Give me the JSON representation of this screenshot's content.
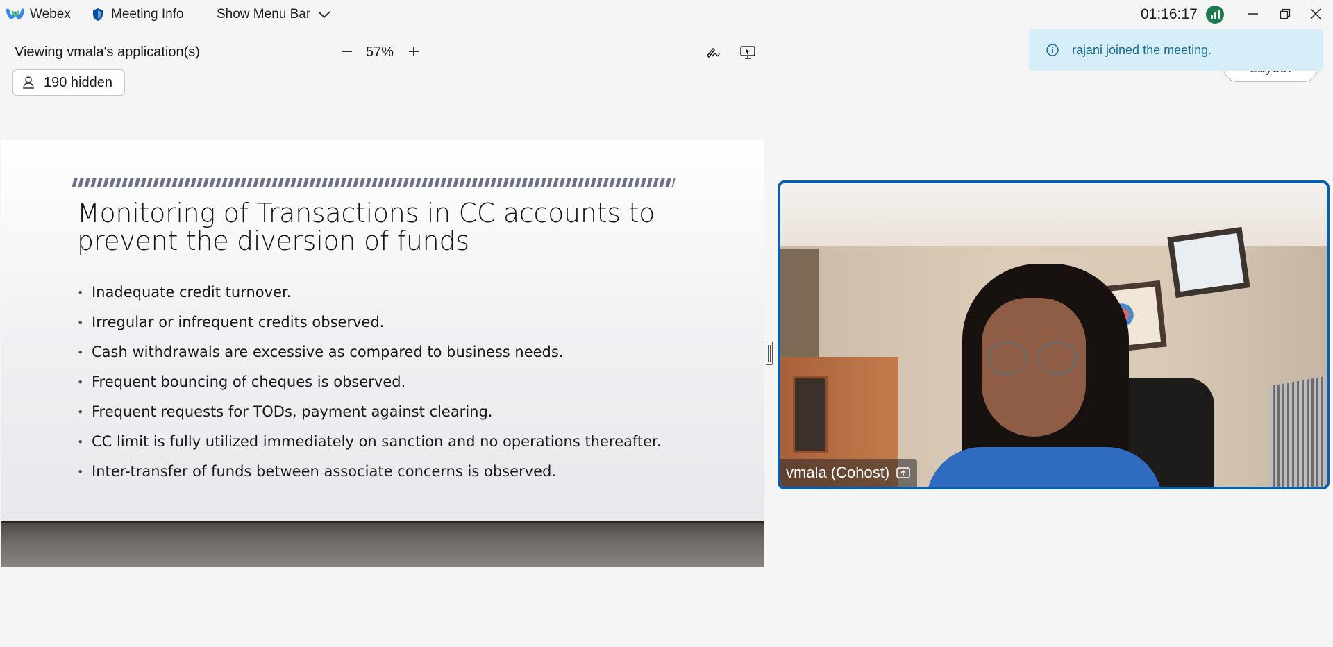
{
  "titlebar": {
    "app_name": "Webex",
    "meeting_info": "Meeting Info",
    "show_menu_bar": "Show Menu Bar",
    "clock": "01:16:17"
  },
  "share_header": {
    "viewing": "Viewing vmala's application(s)",
    "zoom_level": "57%",
    "hidden_participants": "190 hidden"
  },
  "notification": {
    "message": "rajani joined the meeting.",
    "layout_button": "Layout"
  },
  "slide": {
    "title_line1": "Monitoring of Transactions in CC accounts to",
    "title_line2": "prevent the diversion of funds",
    "bullets": [
      " Inadequate credit turnover.",
      "Irregular or infrequent credits observed.",
      "Cash withdrawals are excessive as compared to business needs.",
      " Frequent bouncing of cheques is observed.",
      " Frequent requests for TODs, payment against clearing.",
      "CC limit is fully utilized immediately on sanction and no operations thereafter.",
      "Inter-transfer of funds between associate concerns is observed."
    ]
  },
  "video": {
    "participant_label": "vmala (Cohost)"
  },
  "colors": {
    "accent_blue": "#0b5cab",
    "toast_bg": "#d5eef7",
    "toast_text": "#186a8c",
    "signal_green": "#1d7a4f"
  }
}
